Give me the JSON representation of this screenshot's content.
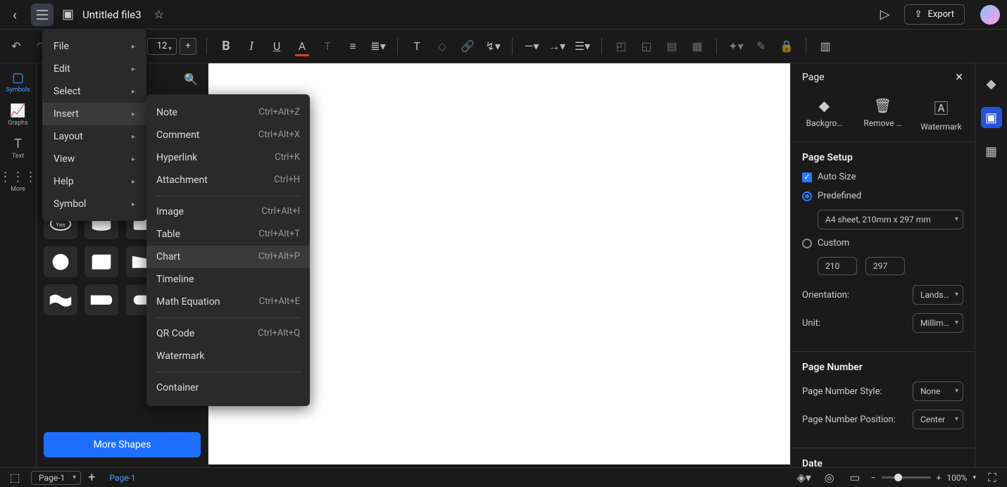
{
  "header": {
    "title": "Untitled file3",
    "export_label": "Export"
  },
  "toolbar": {
    "font_size": "12"
  },
  "left_rail": {
    "items": [
      {
        "label": "Symbols"
      },
      {
        "label": "Graphs"
      },
      {
        "label": "Text"
      },
      {
        "label": "More"
      }
    ]
  },
  "shapes": {
    "more_label": "More Shapes",
    "yes_label": "Yes"
  },
  "main_menu": {
    "items": [
      {
        "label": "File",
        "submenu": true
      },
      {
        "label": "Edit",
        "submenu": true
      },
      {
        "label": "Select",
        "submenu": true
      },
      {
        "label": "Insert",
        "submenu": true,
        "hovered": true
      },
      {
        "label": "Layout",
        "submenu": true
      },
      {
        "label": "View",
        "submenu": true
      },
      {
        "label": "Help",
        "submenu": true
      },
      {
        "label": "Symbol",
        "submenu": true
      }
    ]
  },
  "insert_menu": {
    "groups": [
      [
        {
          "label": "Note",
          "shortcut": "Ctrl+Alt+Z"
        },
        {
          "label": "Comment",
          "shortcut": "Ctrl+Alt+X"
        },
        {
          "label": "Hyperlink",
          "shortcut": "Ctrl+K"
        },
        {
          "label": "Attachment",
          "shortcut": "Ctrl+H"
        }
      ],
      [
        {
          "label": "Image",
          "shortcut": "Ctrl+Alt+I"
        },
        {
          "label": "Table",
          "shortcut": "Ctrl+Alt+T"
        },
        {
          "label": "Chart",
          "shortcut": "Ctrl+Alt+P",
          "hovered": true
        },
        {
          "label": "Timeline",
          "shortcut": ""
        },
        {
          "label": "Math Equation",
          "shortcut": "Ctrl+Alt+E"
        }
      ],
      [
        {
          "label": "QR Code",
          "shortcut": "Ctrl+Alt+Q"
        },
        {
          "label": "Watermark",
          "shortcut": ""
        }
      ],
      [
        {
          "label": "Container",
          "shortcut": ""
        }
      ]
    ]
  },
  "right_panel": {
    "title": "Page",
    "actions": {
      "background": "Backgro…",
      "remove": "Remove …",
      "watermark": "Watermark"
    },
    "page_setup": {
      "heading": "Page Setup",
      "auto_size_label": "Auto Size",
      "predefined_label": "Predefined",
      "predefined_value": "A4 sheet, 210mm x 297 mm",
      "custom_label": "Custom",
      "width": "210",
      "height": "297",
      "orientation_label": "Orientation:",
      "orientation_value": "Lands…",
      "unit_label": "Unit:",
      "unit_value": "Millim…"
    },
    "page_number": {
      "heading": "Page Number",
      "style_label": "Page Number Style:",
      "style_value": "None",
      "position_label": "Page Number Position:",
      "position_value": "Center"
    },
    "date": {
      "heading": "Date"
    }
  },
  "bottom": {
    "page_select": "Page-1",
    "tab_label": "Page-1",
    "zoom_label": "100%"
  }
}
